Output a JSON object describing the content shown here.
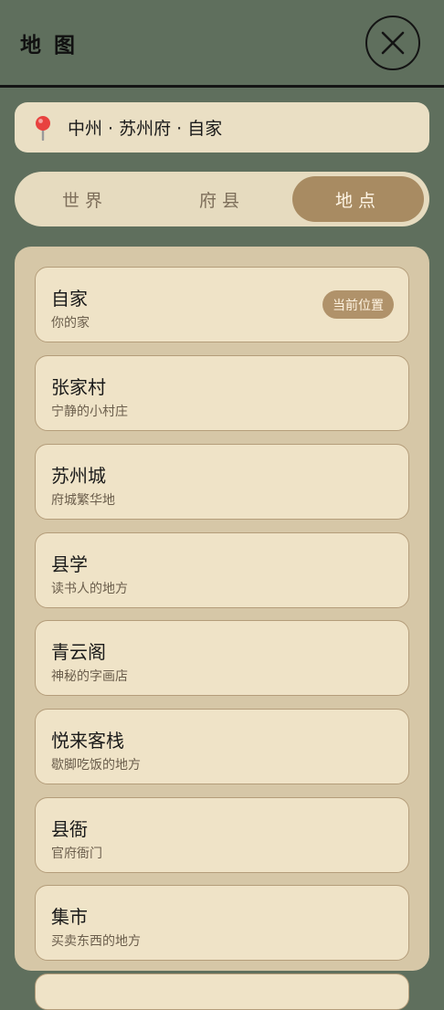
{
  "header": {
    "title": "地 图"
  },
  "location": {
    "path": "中州 · 苏州府 · 自家"
  },
  "tabs": [
    {
      "label": "世界",
      "active": false
    },
    {
      "label": "府县",
      "active": false
    },
    {
      "label": "地点",
      "active": true
    }
  ],
  "places": [
    {
      "name": "自家",
      "desc": "你的家",
      "badge": "当前位置"
    },
    {
      "name": "张家村",
      "desc": "宁静的小村庄"
    },
    {
      "name": "苏州城",
      "desc": "府城繁华地"
    },
    {
      "name": "县学",
      "desc": "读书人的地方"
    },
    {
      "name": "青云阁",
      "desc": "神秘的字画店"
    },
    {
      "name": "悦来客栈",
      "desc": "歇脚吃饭的地方"
    },
    {
      "name": "县衙",
      "desc": "官府衙门"
    },
    {
      "name": "集市",
      "desc": "买卖东西的地方"
    }
  ],
  "colors": {
    "background": "#5f6f5d",
    "card": "#efe3c7",
    "accent": "#a88b62"
  }
}
